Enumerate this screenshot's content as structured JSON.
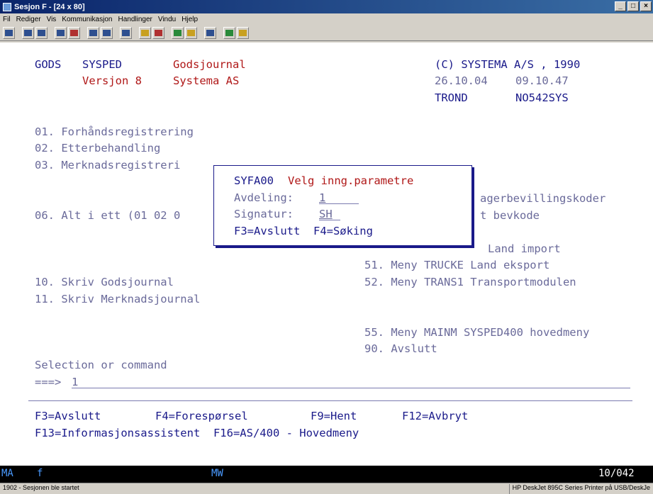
{
  "window": {
    "title": "Sesjon F - [24 x 80]"
  },
  "menu": [
    "Fil",
    "Rediger",
    "Vis",
    "Kommunikasjon",
    "Handlinger",
    "Vindu",
    "Hjelp"
  ],
  "header": {
    "app": "GODS",
    "system": "SYSPED",
    "module": "Godsjournal",
    "copyright": "(C) SYSTEMA A/S , 1990",
    "version": "Versjon 8",
    "company": "Systema AS",
    "date": "26.10.04",
    "time": "09.10.47",
    "user": "TROND",
    "device": "NO542SYS"
  },
  "menu_left": [
    "01. Forhåndsregistrering",
    "02. Etterbehandling",
    "03. Merknadsregistreri",
    "06. Alt i ett (01 02 0",
    "10. Skriv Godsjournal",
    "11. Skriv Merknadsjournal"
  ],
  "menu_right": {
    "frag1": "agerbevillingskoder",
    "frag2": "t bevkode",
    "frag3": "Land import",
    "item51": "51. Meny TRUCKE Land eksport",
    "item52": "52. Meny TRANS1 Transportmodulen",
    "item55": "55. Meny MAINM SYSPED400 hovedmeny",
    "item90": "90. Avslutt"
  },
  "dialog": {
    "id": "SYFA00",
    "title": "Velg inng.parametre",
    "avdeling_label": "Avdeling:",
    "avdeling_value": "1",
    "signatur_label": "Signatur:",
    "signatur_value": "SH",
    "keys": "F3=Avslutt  F4=Søking"
  },
  "command": {
    "label": "Selection or command",
    "prompt": "===>",
    "value": "1"
  },
  "fkeys": {
    "row1": [
      "F3=Avslutt",
      "F4=Forespørsel",
      "F9=Hent",
      "F12=Avbryt"
    ],
    "row2": "F13=Informasjonsassistent  F16=AS/400 - Hovedmeny"
  },
  "status": {
    "left": "MA",
    "f": "f",
    "mw": "MW",
    "pos": "10/042"
  },
  "bottom": {
    "session": "1902 - Sesjonen ble startet",
    "printer": "HP DeskJet 895C Series Printer på USB/DeskJe"
  }
}
